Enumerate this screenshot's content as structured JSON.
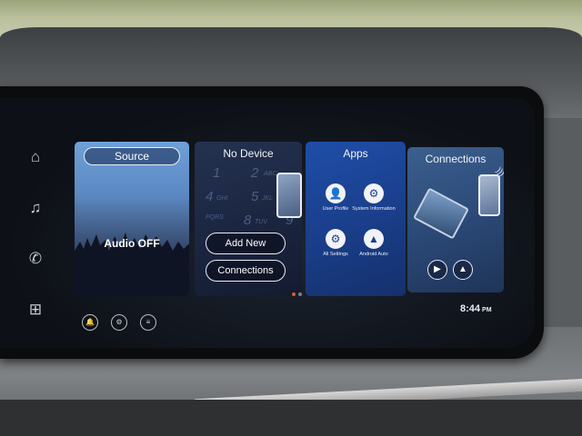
{
  "side_nav": [
    {
      "name": "home",
      "icon": "home-icon",
      "glyph": "⌂"
    },
    {
      "name": "music",
      "icon": "music-note-icon",
      "glyph": "♫"
    },
    {
      "name": "phone",
      "icon": "phone-icon",
      "glyph": "✆"
    },
    {
      "name": "apps",
      "icon": "app-grid-icon",
      "glyph": "⊞"
    }
  ],
  "tiles": {
    "source": {
      "button_label": "Source",
      "status": "Audio OFF"
    },
    "device": {
      "title": "No Device",
      "keypad_digits": [
        "1",
        "2",
        "4",
        "5",
        "7",
        "8",
        "9"
      ],
      "keypad_letters": [
        "ABC",
        "GHI",
        "JKL",
        "PQRS",
        "TUV"
      ],
      "add_new_label": "Add New",
      "connections_label": "Connections"
    },
    "apps": {
      "title": "Apps",
      "items": [
        {
          "label": "User Profile",
          "glyph": "👤"
        },
        {
          "label": "System Information",
          "glyph": "⚙"
        },
        {
          "label": "All Settings",
          "glyph": "⚙"
        },
        {
          "label": "Android Auto",
          "glyph": "▲"
        }
      ]
    },
    "connections": {
      "title": "Connections",
      "buttons": [
        {
          "name": "carplay",
          "glyph": "▶"
        },
        {
          "name": "android-auto",
          "glyph": "▲"
        }
      ]
    }
  },
  "bottom_bar": [
    {
      "name": "notification",
      "glyph": "🔔"
    },
    {
      "name": "settings",
      "glyph": "⚙"
    },
    {
      "name": "sliders",
      "glyph": "≡"
    }
  ],
  "clock": {
    "time": "8:44",
    "ampm": "PM"
  },
  "colors": {
    "page_indicator_active": "#e05a2b",
    "apps_tile": "#1a3f8c"
  }
}
